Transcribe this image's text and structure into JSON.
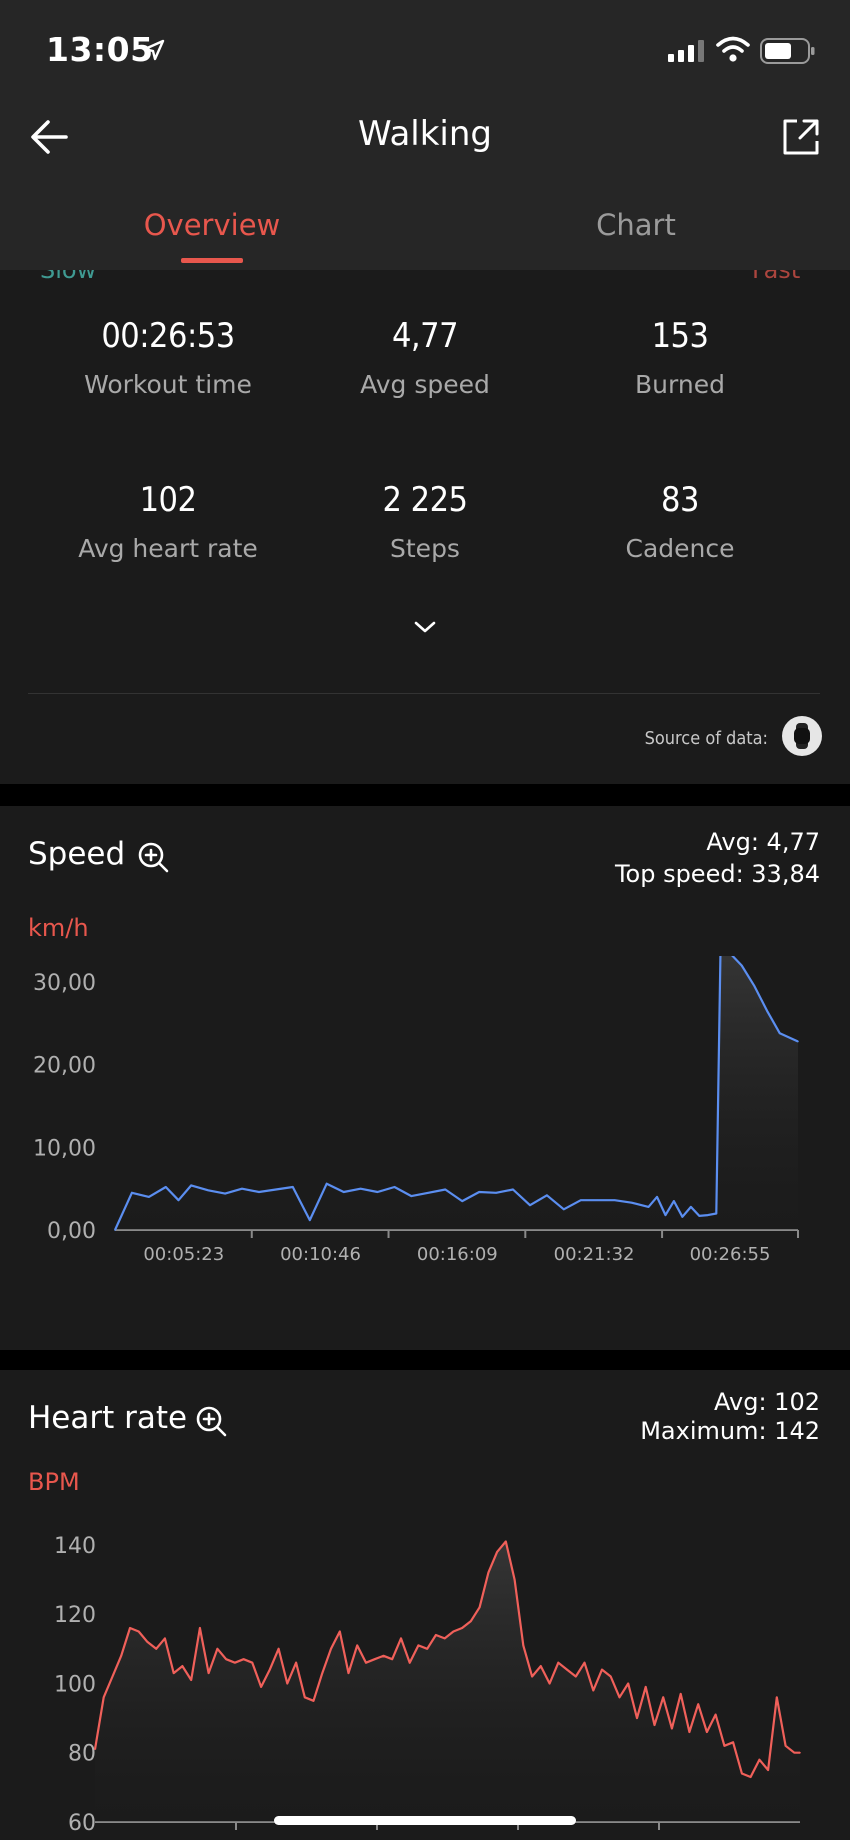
{
  "status": {
    "time": "13:05"
  },
  "header": {
    "title": "Walking"
  },
  "tabs": [
    {
      "label": "Overview",
      "active": true
    },
    {
      "label": "Chart",
      "active": false
    }
  ],
  "pace_scale": {
    "slow": "Slow",
    "fast": "Fast"
  },
  "stats": [
    {
      "value": "00:26:53",
      "label": "Workout time"
    },
    {
      "value": "4,77",
      "label": "Avg speed"
    },
    {
      "value": "153",
      "label": "Burned"
    },
    {
      "value": "102",
      "label": "Avg heart rate"
    },
    {
      "value": "2 225",
      "label": "Steps"
    },
    {
      "value": "83",
      "label": "Cadence"
    }
  ],
  "source": {
    "label": "Source of data:"
  },
  "speed": {
    "title": "Speed",
    "avg_text": "Avg: 4,77",
    "top_text": "Top speed: 33,84",
    "unit": "km/h"
  },
  "heart": {
    "title": "Heart rate",
    "avg_text": "Avg: 102",
    "max_text": "Maximum: 142",
    "unit": "BPM"
  },
  "colors": {
    "accent": "#e8574d",
    "speed_line": "#5b8ef0",
    "hr_line": "#f0605a",
    "card_bg": "#1b1b1b",
    "header_bg": "#262626"
  },
  "chart_data": [
    {
      "type": "line",
      "title": "Speed",
      "ylabel": "km/h",
      "ylim": [
        0,
        30
      ],
      "y_ticks": [
        "0,00",
        "10,00",
        "20,00",
        "30,00"
      ],
      "y_tick_values": [
        0,
        10,
        20,
        30
      ],
      "x_ticks": [
        "00:05:23",
        "00:10:46",
        "00:16:09",
        "00:21:32",
        "00:26:55"
      ],
      "x_tick_values": [
        323,
        646,
        969,
        1292,
        1615
      ],
      "xlim": [
        0,
        1613
      ],
      "series": [
        {
          "x": [
            0,
            40,
            80,
            120,
            150,
            180,
            220,
            260,
            300,
            340,
            380,
            420,
            460,
            500,
            540,
            580,
            620,
            660,
            700,
            740,
            780,
            820,
            860,
            900,
            940,
            980,
            1020,
            1060,
            1100,
            1140,
            1180,
            1220,
            1260,
            1280,
            1300,
            1320,
            1340,
            1360,
            1380,
            1400,
            1420,
            1430,
            1450,
            1480,
            1510,
            1540,
            1570,
            1613
          ],
          "y": [
            0,
            4.5,
            4.0,
            5.2,
            3.6,
            5.4,
            4.8,
            4.4,
            5.0,
            4.6,
            4.9,
            5.2,
            1.2,
            5.6,
            4.6,
            5.0,
            4.6,
            5.2,
            4.1,
            4.5,
            4.9,
            3.5,
            4.6,
            4.5,
            4.9,
            3.0,
            4.2,
            2.5,
            3.6,
            3.6,
            3.6,
            3.3,
            2.8,
            4.0,
            1.8,
            3.5,
            1.6,
            2.8,
            1.7,
            1.8,
            2.0,
            33.8,
            33.6,
            32.0,
            29.5,
            26.5,
            23.8,
            22.8
          ]
        }
      ]
    },
    {
      "type": "line",
      "title": "Heart rate",
      "ylabel": "BPM",
      "ylim": [
        60,
        142
      ],
      "y_ticks": [
        "60",
        "80",
        "100",
        "120",
        "140"
      ],
      "y_tick_values": [
        60,
        80,
        100,
        120,
        140
      ],
      "xlim": [
        0,
        1613
      ],
      "series": [
        {
          "x": [
            0,
            20,
            40,
            60,
            80,
            100,
            120,
            140,
            160,
            180,
            200,
            220,
            240,
            260,
            280,
            300,
            320,
            340,
            360,
            380,
            400,
            420,
            440,
            460,
            480,
            500,
            520,
            540,
            560,
            580,
            600,
            620,
            640,
            660,
            680,
            700,
            720,
            740,
            760,
            780,
            800,
            820,
            840,
            860,
            880,
            900,
            920,
            940,
            960,
            980,
            1000,
            1020,
            1040,
            1060,
            1080,
            1100,
            1120,
            1140,
            1160,
            1180,
            1200,
            1220,
            1240,
            1260,
            1280,
            1300,
            1320,
            1340,
            1360,
            1380,
            1400,
            1420,
            1440,
            1460,
            1480,
            1500,
            1520,
            1540,
            1560,
            1580,
            1600,
            1613
          ],
          "y": [
            81,
            96,
            102,
            108,
            116,
            115,
            112,
            110,
            113,
            103,
            105,
            101,
            116,
            103,
            110,
            107,
            106,
            107,
            106,
            99,
            104,
            110,
            100,
            106,
            96,
            95,
            103,
            110,
            115,
            103,
            111,
            106,
            107,
            108,
            107,
            113,
            106,
            111,
            110,
            114,
            113,
            115,
            116,
            118,
            122,
            132,
            138,
            141,
            130,
            111,
            102,
            105,
            100,
            106,
            104,
            102,
            106,
            98,
            104,
            102,
            96,
            100,
            90,
            99,
            88,
            96,
            87,
            97,
            86,
            94,
            86,
            91,
            82,
            83,
            74,
            73,
            78,
            75,
            96,
            82,
            80,
            80
          ]
        }
      ]
    }
  ]
}
